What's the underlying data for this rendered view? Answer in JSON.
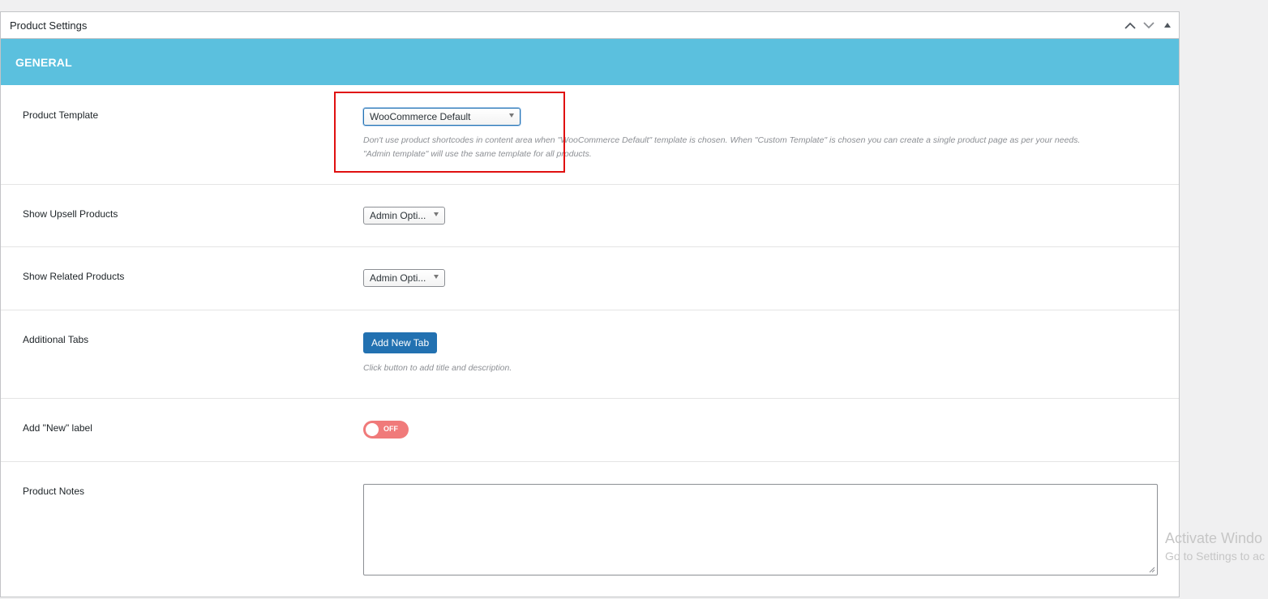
{
  "panel": {
    "title": "Product Settings",
    "controls": {
      "move_up": "chevron-up-icon",
      "move_down": "chevron-down-icon",
      "toggle": "triangle-up-icon"
    }
  },
  "section": {
    "title": "GENERAL",
    "color": "#5bc0de"
  },
  "rows": {
    "product_template": {
      "label": "Product Template",
      "selected": "WooCommerce Default",
      "help_line1": "Don't use product shortcodes in content area when \"WooCommerce Default\" template is chosen. When \"Custom Template\" is chosen you can create a single product page as per your needs.",
      "help_line2": "\"Admin template\" will use the same template for all products."
    },
    "upsell": {
      "label": "Show Upsell Products",
      "selected": "Admin Opti..."
    },
    "related": {
      "label": "Show Related Products",
      "selected": "Admin Opti..."
    },
    "tabs": {
      "label": "Additional Tabs",
      "button": "Add New Tab",
      "help": "Click button to add title and description."
    },
    "new_label": {
      "label": "Add \"New\" label",
      "toggle_text": "OFF",
      "toggle_on": false
    },
    "notes": {
      "label": "Product Notes",
      "value": ""
    }
  },
  "watermark": {
    "line1": "Activate Windo",
    "line2": "Go to Settings to ac"
  },
  "colors": {
    "primary_button": "#2271b1",
    "toggle_off": "#f07a7a",
    "highlight_box": "#e01010"
  }
}
